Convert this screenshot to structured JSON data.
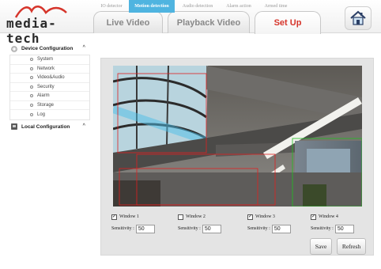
{
  "brand": {
    "logo_text": "media-tech",
    "accent": "#d6352b"
  },
  "nav": {
    "tabs": [
      {
        "label": "Live Video",
        "active": false
      },
      {
        "label": "Playback Video",
        "active": false
      },
      {
        "label": "Set Up",
        "active": true
      }
    ],
    "home_icon": "home-icon"
  },
  "sidebar": {
    "device_group": {
      "label": "Device Configuration",
      "expanded": true
    },
    "items": [
      "System",
      "Network",
      "Video&Audio",
      "Security",
      "Alarm",
      "Storage",
      "Log"
    ],
    "local_group": {
      "label": "Local Configuration",
      "expanded": true
    }
  },
  "subtabs": [
    {
      "label": "IO detector",
      "active": false
    },
    {
      "label": "Motion detection",
      "active": true
    },
    {
      "label": "Audio detection",
      "active": false
    },
    {
      "label": "Alarm action",
      "active": false
    },
    {
      "label": "Armed time",
      "active": false
    }
  ],
  "windows": [
    {
      "label": "Window 1",
      "checked": true,
      "sensitivity_label": "Sensitivity :",
      "sensitivity": "50",
      "color": "#e02020"
    },
    {
      "label": "Window 2",
      "checked": false,
      "sensitivity_label": "Sensitivity :",
      "sensitivity": "50",
      "color": "#e02020"
    },
    {
      "label": "Window 3",
      "checked": true,
      "sensitivity_label": "Sensitivity :",
      "sensitivity": "50",
      "color": "#e02020"
    },
    {
      "label": "Window 4",
      "checked": true,
      "sensitivity_label": "Sensitivity :",
      "sensitivity": "50",
      "color": "#20c020"
    }
  ],
  "buttons": {
    "save": "Save",
    "refresh": "Refresh"
  },
  "colors": {
    "active_subtab": "#4fb4e0",
    "panel_bg": "#e4e4e4"
  }
}
